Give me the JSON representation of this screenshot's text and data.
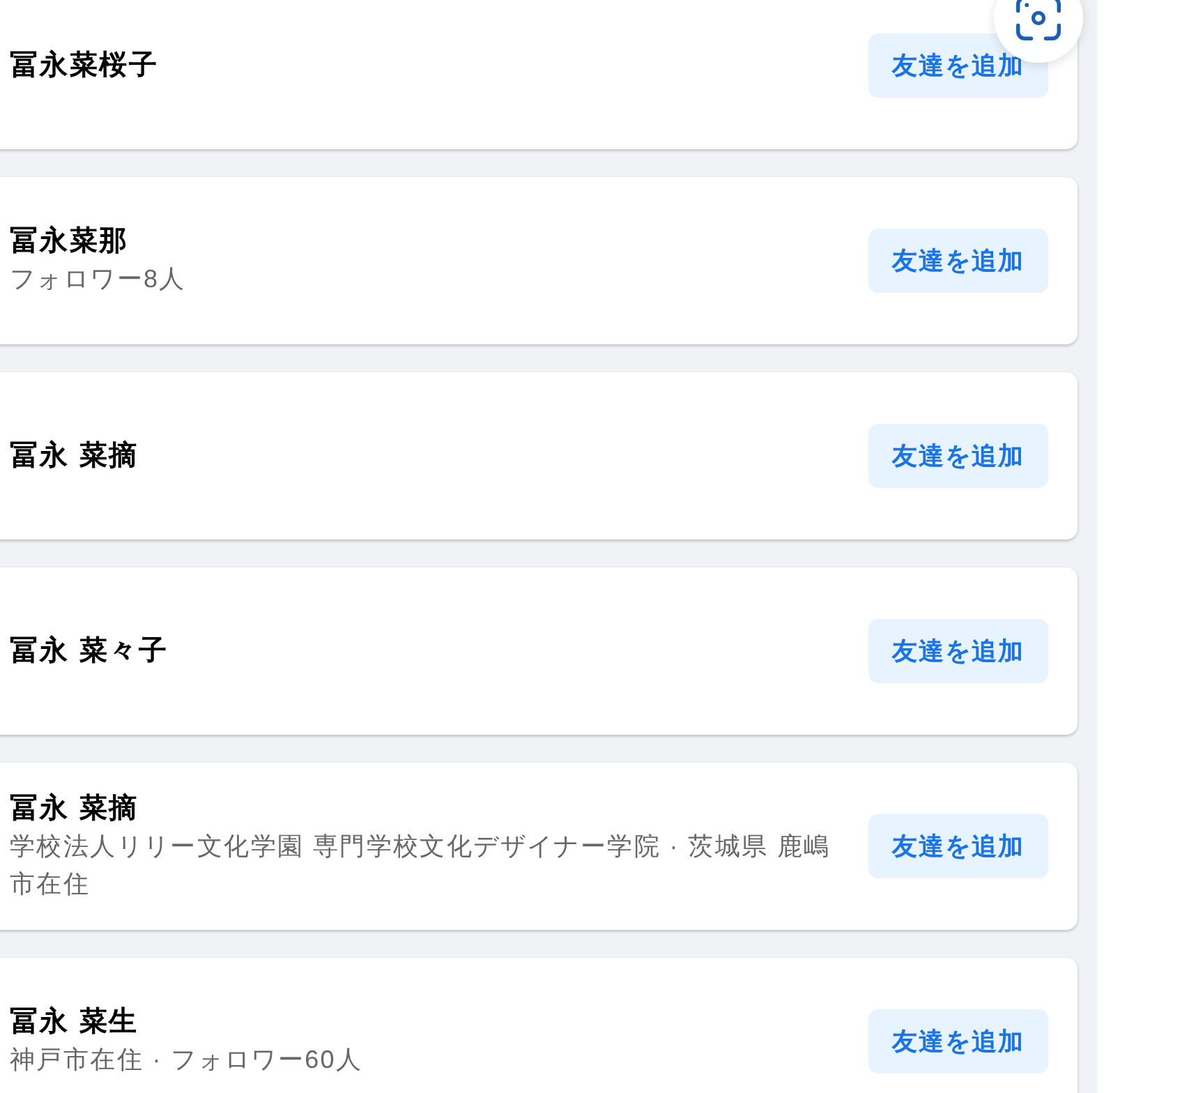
{
  "people": [
    {
      "name": "冨永菜桜子",
      "button": "友達を追加"
    },
    {
      "name": "冨永菜那",
      "subtitle": "フォロワー8人",
      "button": "友達を追加"
    },
    {
      "name": "冨永 菜摘",
      "button": "友達を追加"
    },
    {
      "name": "冨永 菜々子",
      "button": "友達を追加"
    },
    {
      "name": "冨永 菜摘",
      "subtitle": "学校法人リリー文化学園 専門学校文化デザイナー学院 · 茨城県 鹿嶋市在住",
      "button": "友達を追加"
    },
    {
      "name": "冨永 菜生",
      "subtitle": "神戸市在住 · フォロワー60人",
      "button": "友達を追加"
    }
  ]
}
